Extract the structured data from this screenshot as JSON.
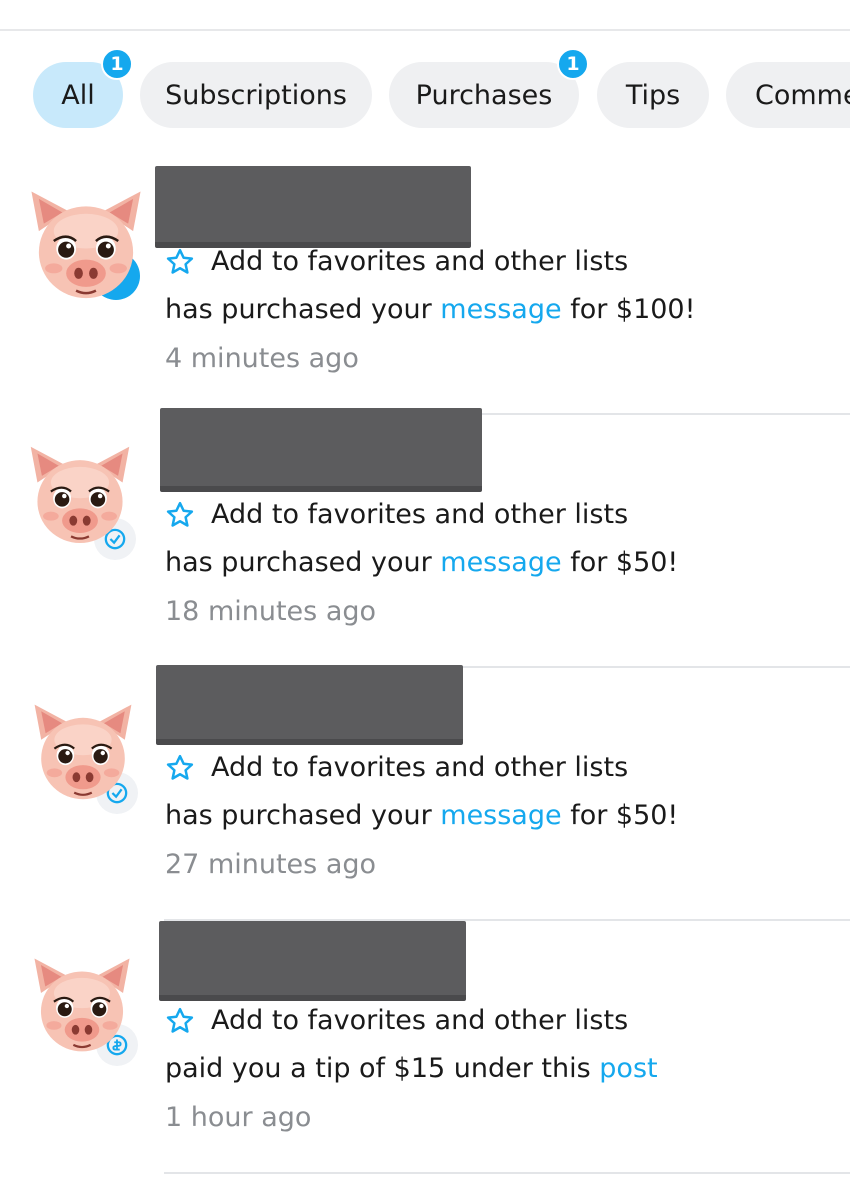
{
  "filters": {
    "items": [
      {
        "label": "All",
        "badge": "1"
      },
      {
        "label": "Subscriptions"
      },
      {
        "label": "Purchases",
        "badge": "1"
      },
      {
        "label": "Tips"
      },
      {
        "label": "Comme"
      }
    ]
  },
  "notifications": [
    {
      "favorites_label": "Add to favorites and other lists",
      "text_before": "has purchased your ",
      "link": "message",
      "text_after": " for $100!",
      "time": "4 minutes ago"
    },
    {
      "favorites_label": "Add to favorites and other lists",
      "text_before": "has purchased your ",
      "link": "message",
      "text_after": " for $50!",
      "time": "18 minutes ago"
    },
    {
      "favorites_label": "Add to favorites and other lists",
      "text_before": "has purchased your ",
      "link": "message",
      "text_after": " for $50!",
      "time": "27 minutes ago"
    },
    {
      "favorites_label": "Add to favorites and other lists",
      "text_before": "paid you a tip of $15 under this ",
      "link": "post",
      "text_after": "",
      "time": "1 hour ago"
    }
  ],
  "colors": {
    "accent": "#15a8ee",
    "active_chip": "#c8e9fb",
    "chip": "#eff0f2",
    "muted_text": "#8a8d91",
    "redaction": "#5c5c5e"
  },
  "icons": {
    "favorites": "star-outline-icon",
    "avatar": "pig-face-avatar",
    "avatar_badge": "verified-badge-icon"
  }
}
